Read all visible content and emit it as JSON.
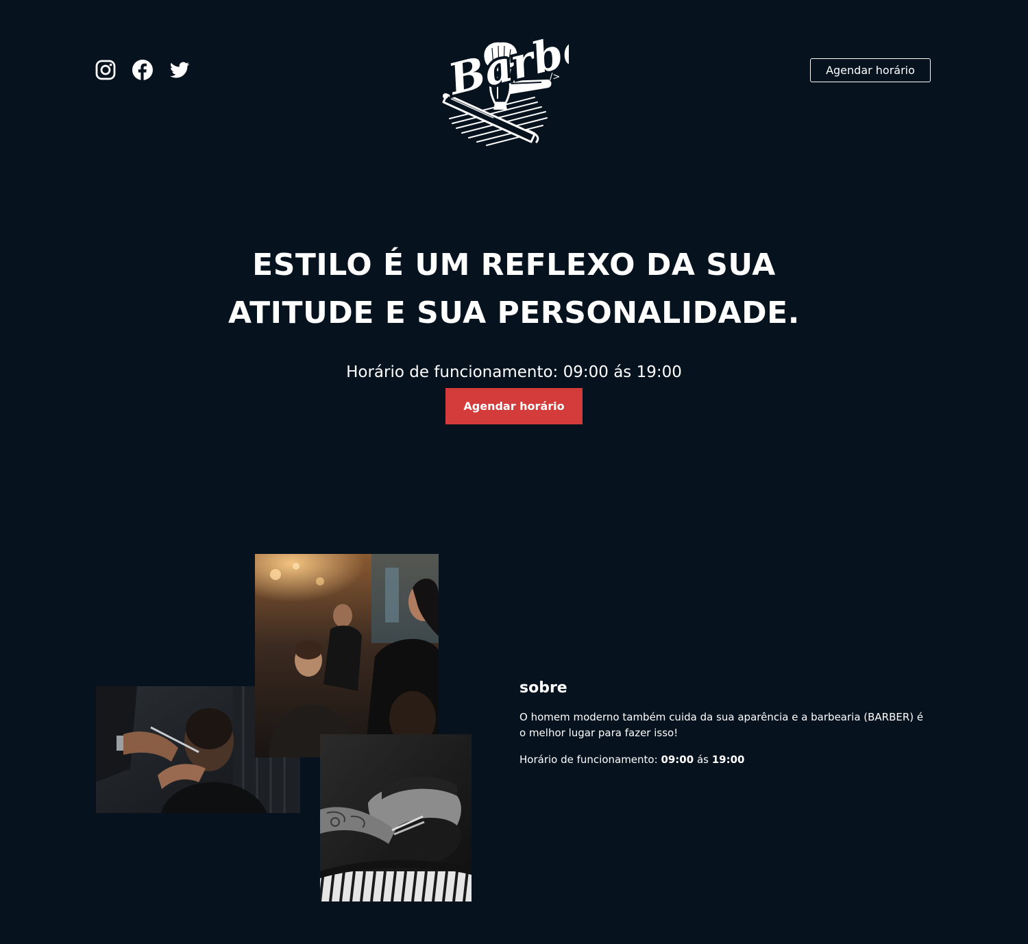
{
  "header": {
    "socials": [
      {
        "name": "instagram",
        "icon": "instagram-icon"
      },
      {
        "name": "facebook",
        "icon": "facebook-icon"
      },
      {
        "name": "twitter",
        "icon": "twitter-icon"
      }
    ],
    "logo_text": "Barber",
    "logo_tag": "/>",
    "cta_label": "Agendar horário"
  },
  "hero": {
    "title_line1": "ESTILO É UM REFLEXO DA SUA",
    "title_line2": "ATITUDE E SUA PERSONALIDADE.",
    "hours": "Horário de funcionamento: 09:00 ás 19:00",
    "cta_label": "Agendar horário"
  },
  "about": {
    "title": "sobre",
    "text": "O homem moderno também cuida da sua aparência e a barbearia (BARBER) é o melhor lugar para fazer isso!",
    "hours_prefix": "Horário de funcionamento: ",
    "hours_open": "09:00",
    "hours_separator": " ás ",
    "hours_close": "19:00"
  },
  "colors": {
    "background": "#07121f",
    "accent": "#d43c3c",
    "text": "#ffffff"
  }
}
